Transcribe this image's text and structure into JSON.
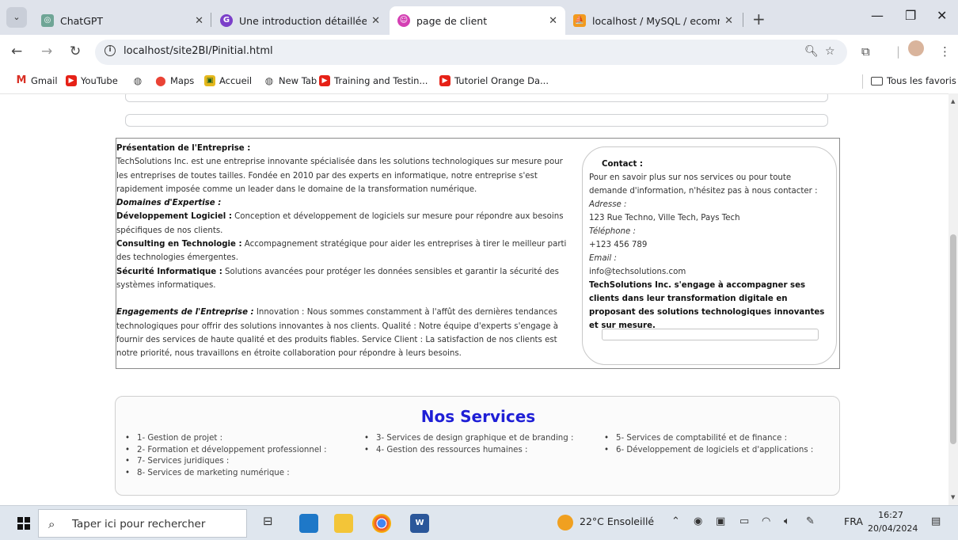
{
  "browser": {
    "tabs": [
      {
        "title": "ChatGPT",
        "favicon": "chatgpt-icon",
        "active": false
      },
      {
        "title": "Une introduction détaillée | Ga",
        "favicon": "gatsby-icon",
        "active": false
      },
      {
        "title": "page de client",
        "favicon": "page-icon",
        "active": true
      },
      {
        "title": "localhost / MySQL / ecommun",
        "favicon": "phpmyadmin-icon",
        "active": false
      }
    ],
    "url": "localhost/site2BI/Pinitial.html",
    "bookmarks": [
      {
        "label": "Gmail",
        "icon": "gmail-icon"
      },
      {
        "label": "YouTube",
        "icon": "youtube-icon"
      },
      {
        "label": "",
        "icon": "globe-icon"
      },
      {
        "label": "Maps",
        "icon": "maps-icon"
      },
      {
        "label": "Accueil",
        "icon": "accueil-icon"
      },
      {
        "label": "New Tab",
        "icon": "globe-icon"
      },
      {
        "label": "Training and Testin...",
        "icon": "youtube-icon"
      },
      {
        "label": "Tutoriel Orange Da...",
        "icon": "youtube-icon"
      }
    ],
    "all_bookmarks": "Tous les favoris"
  },
  "page": {
    "presentation": {
      "title": "Présentation de l'Entreprise :",
      "intro": "TechSolutions Inc. est une entreprise innovante spécialisée dans les solutions technologiques sur mesure pour les entreprises de toutes tailles. Fondée en 2010 par des experts en informatique, notre entreprise s'est rapidement imposée comme un leader dans le domaine de la transformation numérique.",
      "domains_title": "Domaines d'Expertise :",
      "domains": [
        {
          "name": "Développement Logiciel :",
          "text": " Conception et développement de logiciels sur mesure pour répondre aux besoins spécifiques de nos clients."
        },
        {
          "name": "Consulting en Technologie :",
          "text": " Accompagnement stratégique pour aider les entreprises à tirer le meilleur parti des technologies émergentes."
        },
        {
          "name": "Sécurité Informatique :",
          "text": " Solutions avancées pour protéger les données sensibles et garantir la sécurité des systèmes informatiques."
        }
      ],
      "engagements_title": "Engagements de l'Entreprise :",
      "engagements": " Innovation : Nous sommes constamment à l'affût des dernières tendances technologiques pour offrir des solutions innovantes à nos clients. Qualité : Notre équipe d'experts s'engage à fournir des services de haute qualité et des produits fiables. Service Client : La satisfaction de nos clients est notre priorité, nous travaillons en étroite collaboration pour répondre à leurs besoins."
    },
    "contact": {
      "title": "Contact :",
      "intro": "Pour en savoir plus sur nos services ou pour toute demande d'information, n'hésitez pas à nous contacter :",
      "address_label": "Adresse :",
      "address": "123 Rue Techno, Ville Tech, Pays Tech",
      "phone_label": "Téléphone :",
      "phone": "+123 456 789",
      "email_label": "Email :",
      "email": "info@techsolutions.com",
      "commitment": "TechSolutions Inc. s'engage à accompagner ses clients dans leur transformation digitale en proposant des solutions technologiques innovantes et sur mesure."
    },
    "services": {
      "title": "Nos Services",
      "col1": [
        "1- Gestion de projet :",
        "2- Formation et développement professionnel :",
        "7- Services juridiques :",
        "8- Services de marketing numérique :"
      ],
      "col2": [
        "3- Services de design graphique et de branding :",
        "4- Gestion des ressources humaines :"
      ],
      "col3": [
        "5- Services de comptabilité et de finance :",
        "6- Développement de logiciels et d'applications :"
      ]
    }
  },
  "taskbar": {
    "search_placeholder": "Taper ici pour rechercher",
    "weather": "22°C Ensoleillé",
    "language": "FRA",
    "time": "16:27",
    "date": "20/04/2024"
  },
  "colors": {
    "services_title": "#1f1fd6",
    "tab_strip": "#dfe3eb",
    "taskbar": "#dfe6ee"
  }
}
